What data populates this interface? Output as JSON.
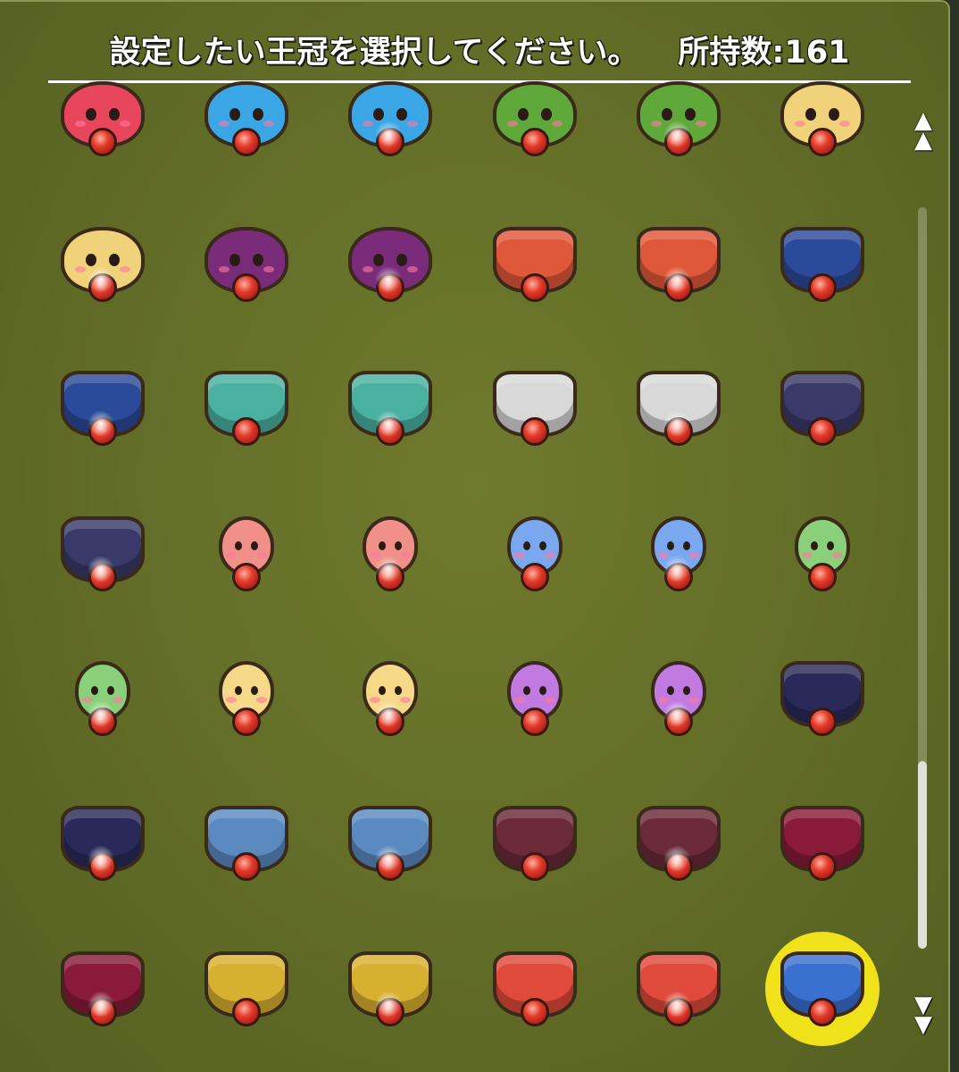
{
  "header": {
    "instruction": "設定したい王冠を選択してください。",
    "owned_count": "所持数:161"
  },
  "scroll": {
    "up_icon": "double-up-arrow-icon",
    "down_icon": "double-down-arrow-icon",
    "up_glyph": "▲",
    "down_glyph": "▼",
    "position_fraction": 1.0
  },
  "crowns": [
    {
      "kind": "blob",
      "color": "#e8465c",
      "sparkle": false
    },
    {
      "kind": "blob",
      "color": "#3aa6e6",
      "sparkle": false
    },
    {
      "kind": "blob",
      "color": "#3aa6e6",
      "sparkle": true
    },
    {
      "kind": "blob",
      "color": "#5fa83a",
      "sparkle": false
    },
    {
      "kind": "blob",
      "color": "#5fa83a",
      "sparkle": true
    },
    {
      "kind": "blob",
      "color": "#f0d27a",
      "sparkle": false
    },
    {
      "kind": "blob",
      "color": "#f0d27a",
      "sparkle": true
    },
    {
      "kind": "blob",
      "color": "#7a2c7a",
      "sparkle": false
    },
    {
      "kind": "blob",
      "color": "#7a2c7a",
      "sparkle": true
    },
    {
      "kind": "spiky",
      "color": "#e0583a",
      "sparkle": false
    },
    {
      "kind": "spiky",
      "color": "#e0583a",
      "sparkle": true
    },
    {
      "kind": "spiky",
      "color": "#2c4a9a",
      "sparkle": false
    },
    {
      "kind": "spiky",
      "color": "#2c4a9a",
      "sparkle": true
    },
    {
      "kind": "spiky",
      "color": "#4ab0a0",
      "sparkle": false
    },
    {
      "kind": "spiky",
      "color": "#4ab0a0",
      "sparkle": true
    },
    {
      "kind": "spiky",
      "color": "#d8d8d8",
      "sparkle": false
    },
    {
      "kind": "spiky",
      "color": "#d8d8d8",
      "sparkle": true
    },
    {
      "kind": "spiky",
      "color": "#3a3a6a",
      "sparkle": false
    },
    {
      "kind": "spiky",
      "color": "#3a3a6a",
      "sparkle": true
    },
    {
      "kind": "drop",
      "color": "#f09088",
      "sparkle": false
    },
    {
      "kind": "drop",
      "color": "#f09088",
      "sparkle": true
    },
    {
      "kind": "drop",
      "color": "#7aa8f0",
      "sparkle": false
    },
    {
      "kind": "drop",
      "color": "#7aa8f0",
      "sparkle": true
    },
    {
      "kind": "drop",
      "color": "#8ad07a",
      "sparkle": false
    },
    {
      "kind": "drop",
      "color": "#8ad07a",
      "sparkle": true
    },
    {
      "kind": "drop",
      "color": "#f5d888",
      "sparkle": false
    },
    {
      "kind": "drop",
      "color": "#f5d888",
      "sparkle": true
    },
    {
      "kind": "drop",
      "color": "#c07ae0",
      "sparkle": false
    },
    {
      "kind": "drop",
      "color": "#c07ae0",
      "sparkle": true
    },
    {
      "kind": "spiky",
      "color": "#2a2a5a",
      "sparkle": false
    },
    {
      "kind": "spiky",
      "color": "#2a2a5a",
      "sparkle": true
    },
    {
      "kind": "spiky",
      "color": "#5a8ac0",
      "sparkle": false
    },
    {
      "kind": "spiky",
      "color": "#5a8ac0",
      "sparkle": true
    },
    {
      "kind": "spiky",
      "color": "#6a2a3a",
      "sparkle": false
    },
    {
      "kind": "spiky",
      "color": "#6a2a3a",
      "sparkle": true
    },
    {
      "kind": "spiky",
      "color": "#8a1a3a",
      "sparkle": false
    },
    {
      "kind": "spiky",
      "color": "#8a1a3a",
      "sparkle": true
    },
    {
      "kind": "spiky",
      "color": "#d8b030",
      "sparkle": false
    },
    {
      "kind": "spiky",
      "color": "#d8b030",
      "sparkle": true
    },
    {
      "kind": "spiky",
      "color": "#e04a3a",
      "sparkle": false
    },
    {
      "kind": "spiky",
      "color": "#e04a3a",
      "sparkle": true
    },
    {
      "kind": "spiky",
      "color": "#3a70d0",
      "sparkle": false,
      "selected": true
    }
  ],
  "colors": {
    "panel": "#646f28",
    "selected_ring": "#f0e21a",
    "header_text": "#ffffff"
  }
}
